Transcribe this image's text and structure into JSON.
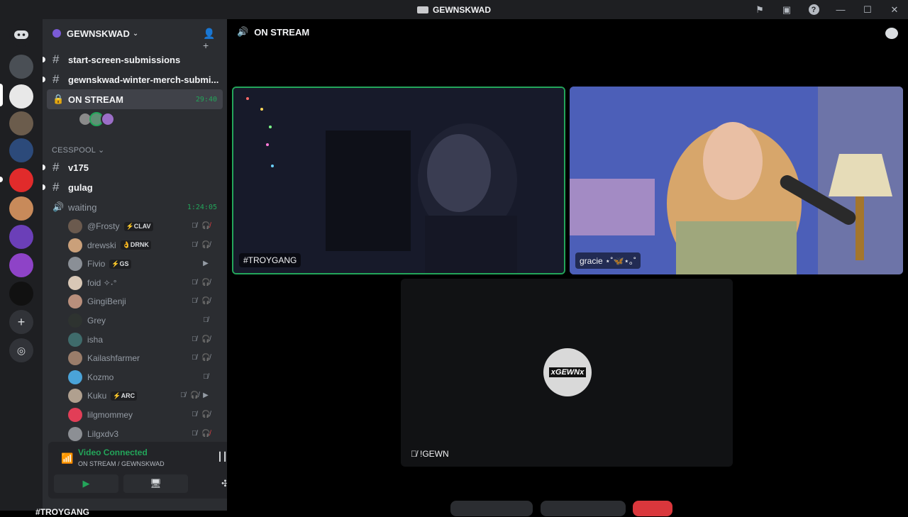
{
  "window": {
    "title": "GEWNSKWAD"
  },
  "guild": {
    "name": "GEWNSKWAD"
  },
  "channels": {
    "text_top": [
      {
        "name": "start-screen-submissions"
      },
      {
        "name": "gewnskwad-winter-merch-submi..."
      }
    ],
    "active_voice": {
      "name": "ON STREAM",
      "time": "29:40"
    },
    "category": "CESSPOOL",
    "cesspool": [
      {
        "name": "v175"
      },
      {
        "name": "gulag"
      }
    ],
    "waiting": {
      "name": "waiting",
      "time": "1:24:05"
    }
  },
  "voice_users": [
    {
      "name": "@Frosty",
      "tag": "⚡CLAV",
      "av": "#6b5a4e",
      "icons": [
        "mic-off",
        "deafen-red"
      ]
    },
    {
      "name": "drewski",
      "tag": "👌DRNK",
      "av": "#caa07a",
      "icons": [
        "mic-off",
        "deafen"
      ]
    },
    {
      "name": "Fivio",
      "tag": "⚡GS",
      "av": "#8a8f96",
      "icons": [
        "video"
      ]
    },
    {
      "name": "foid ✧˖°",
      "tag": "",
      "av": "#d8c7b6",
      "icons": [
        "mic-off",
        "deafen"
      ]
    },
    {
      "name": "GingiBenji",
      "tag": "",
      "av": "#b98f7c",
      "icons": [
        "mic-off",
        "deafen"
      ]
    },
    {
      "name": "Grey",
      "tag": "",
      "av": "#2e3330",
      "icons": [
        "mic-off"
      ]
    },
    {
      "name": "isha",
      "tag": "",
      "av": "#3f6b6b",
      "icons": [
        "mic-off",
        "deafen"
      ]
    },
    {
      "name": "Kailashfarmer",
      "tag": "",
      "av": "#9a7d6a",
      "icons": [
        "mic-off",
        "deafen"
      ]
    },
    {
      "name": "Kozmo",
      "tag": "",
      "av": "#4aa3d8",
      "icons": [
        "mic-off"
      ]
    },
    {
      "name": "Kuku",
      "tag": "⚡ARC",
      "av": "#b0a08f",
      "icons": [
        "mic-off",
        "deafen",
        "video"
      ]
    },
    {
      "name": "lilgmommey",
      "tag": "",
      "av": "#e23e57",
      "icons": [
        "mic-off",
        "deafen"
      ]
    },
    {
      "name": "Lilgxdv3",
      "tag": "",
      "av": "#8c8f94",
      "icons": [
        "mic-off",
        "deafen-red"
      ]
    }
  ],
  "panel": {
    "status": "Video Connected",
    "sub": "ON STREAM / GEWNSKWAD",
    "bottom_user": "#TROYGANG"
  },
  "stage": {
    "title": "ON STREAM",
    "tiles": [
      {
        "label": "#TROYGANG"
      },
      {
        "label": "gracie ⋆˚🦋⋆｡˚"
      },
      {
        "label": "!GEWN"
      }
    ],
    "avatar_text": "xGEWNx"
  },
  "colors": {
    "green": "#23a55a",
    "red": "#f23f43",
    "sidebar": "#2b2d31",
    "rail": "#1e1f22"
  }
}
